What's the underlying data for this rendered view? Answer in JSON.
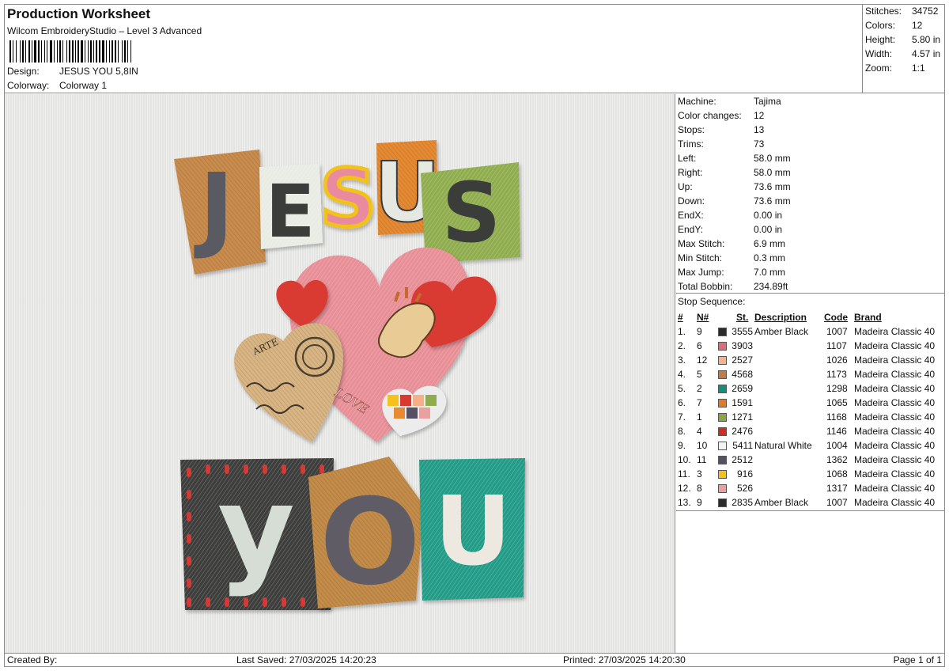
{
  "header": {
    "title": "Production Worksheet",
    "subtitle": "Wilcom EmbroideryStudio – Level 3 Advanced",
    "design_label": "Design:",
    "design_value": "JESUS YOU 5,8IN",
    "colorway_label": "Colorway:",
    "colorway_value": "Colorway 1"
  },
  "summary": [
    {
      "label": "Stitches:",
      "value": "34752"
    },
    {
      "label": "Colors:",
      "value": "12"
    },
    {
      "label": "Height:",
      "value": "5.80 in"
    },
    {
      "label": "Width:",
      "value": "4.57 in"
    },
    {
      "label": "Zoom:",
      "value": "1:1"
    }
  ],
  "machine": [
    {
      "label": "Machine:",
      "value": "Tajima"
    },
    {
      "label": "Color changes:",
      "value": "12"
    },
    {
      "label": "Stops:",
      "value": "13"
    },
    {
      "label": "Trims:",
      "value": "73"
    },
    {
      "label": "Left:",
      "value": "58.0 mm"
    },
    {
      "label": "Right:",
      "value": "58.0 mm"
    },
    {
      "label": "Up:",
      "value": "73.6 mm"
    },
    {
      "label": "Down:",
      "value": "73.6 mm"
    },
    {
      "label": "EndX:",
      "value": "0.00 in"
    },
    {
      "label": "EndY:",
      "value": "0.00 in"
    },
    {
      "label": "Max Stitch:",
      "value": "6.9 mm"
    },
    {
      "label": "Min Stitch:",
      "value": "0.3 mm"
    },
    {
      "label": "Max Jump:",
      "value": "7.0 mm"
    },
    {
      "label": "Total Bobbin:",
      "value": "234.89ft"
    }
  ],
  "stop_sequence": {
    "title": "Stop Sequence:",
    "columns": {
      "index": "#",
      "needle": "N#",
      "stitches": "St.",
      "description": "Description",
      "code": "Code",
      "brand": "Brand"
    },
    "rows": [
      {
        "index": "1.",
        "needle": "9",
        "color": "#2b2b2b",
        "stitches": "3555",
        "description": "Amber Black",
        "code": "1007",
        "brand": "Madeira Classic 40"
      },
      {
        "index": "2.",
        "needle": "6",
        "color": "#e06b7a",
        "stitches": "3903",
        "description": "",
        "code": "1107",
        "brand": "Madeira Classic 40"
      },
      {
        "index": "3.",
        "needle": "12",
        "color": "#f2b48e",
        "stitches": "2527",
        "description": "",
        "code": "1026",
        "brand": "Madeira Classic 40"
      },
      {
        "index": "4.",
        "needle": "5",
        "color": "#c47a45",
        "stitches": "4568",
        "description": "",
        "code": "1173",
        "brand": "Madeira Classic 40"
      },
      {
        "index": "5.",
        "needle": "2",
        "color": "#12907b",
        "stitches": "2659",
        "description": "",
        "code": "1298",
        "brand": "Madeira Classic 40"
      },
      {
        "index": "6.",
        "needle": "7",
        "color": "#e27a26",
        "stitches": "1591",
        "description": "",
        "code": "1065",
        "brand": "Madeira Classic 40"
      },
      {
        "index": "7.",
        "needle": "1",
        "color": "#8aa548",
        "stitches": "1271",
        "description": "",
        "code": "1168",
        "brand": "Madeira Classic 40"
      },
      {
        "index": "8.",
        "needle": "4",
        "color": "#d42a22",
        "stitches": "2476",
        "description": "",
        "code": "1146",
        "brand": "Madeira Classic 40"
      },
      {
        "index": "9.",
        "needle": "10",
        "color": "#f2f2f2",
        "stitches": "5411",
        "description": "Natural White",
        "code": "1004",
        "brand": "Madeira Classic 40"
      },
      {
        "index": "10.",
        "needle": "11",
        "color": "#565065",
        "stitches": "2512",
        "description": "",
        "code": "1362",
        "brand": "Madeira Classic 40"
      },
      {
        "index": "11.",
        "needle": "3",
        "color": "#f5c21c",
        "stitches": "916",
        "description": "",
        "code": "1068",
        "brand": "Madeira Classic 40"
      },
      {
        "index": "12.",
        "needle": "8",
        "color": "#eaa0a0",
        "stitches": "526",
        "description": "",
        "code": "1317",
        "brand": "Madeira Classic 40"
      },
      {
        "index": "13.",
        "needle": "9",
        "color": "#2b2b2b",
        "stitches": "2835",
        "description": "Amber Black",
        "code": "1007",
        "brand": "Madeira Classic 40"
      }
    ]
  },
  "design": {
    "word_top": [
      "J",
      "E",
      "S",
      "U",
      "S"
    ],
    "word_bottom": [
      "y",
      "O",
      "U"
    ],
    "heart_text": "LOVE",
    "stamp_text": "ARTE"
  },
  "footer": {
    "created_by": "Created By:",
    "last_saved": "Last Saved: 27/03/2025 14:20:23",
    "printed": "Printed: 27/03/2025 14:20:30",
    "page": "Page 1 of 1"
  }
}
